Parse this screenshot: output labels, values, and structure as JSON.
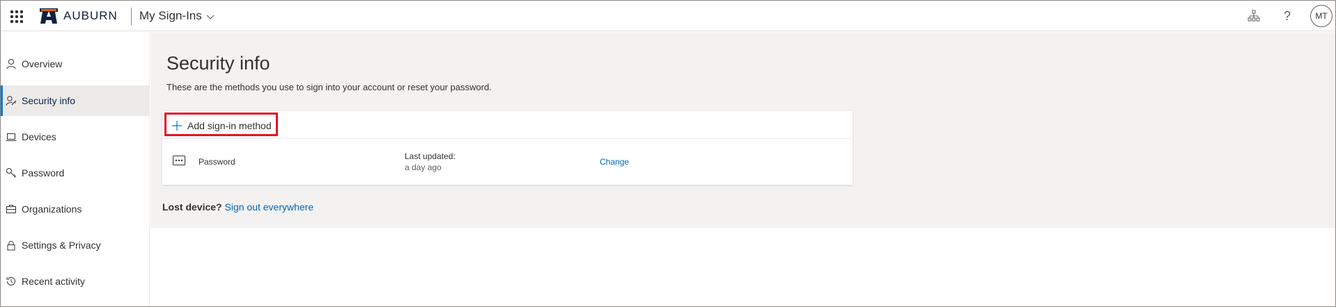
{
  "header": {
    "brand": "AUBURN",
    "app_title": "My Sign-Ins",
    "avatar_initials": "MT",
    "help_symbol": "?"
  },
  "sidebar": {
    "items": [
      {
        "label": "Overview",
        "icon": "person-icon",
        "active": false
      },
      {
        "label": "Security info",
        "icon": "person-key-icon",
        "active": true
      },
      {
        "label": "Devices",
        "icon": "laptop-icon",
        "active": false
      },
      {
        "label": "Password",
        "icon": "key-icon",
        "active": false
      },
      {
        "label": "Organizations",
        "icon": "briefcase-icon",
        "active": false
      },
      {
        "label": "Settings & Privacy",
        "icon": "lock-icon",
        "active": false
      },
      {
        "label": "Recent activity",
        "icon": "history-icon",
        "active": false
      }
    ]
  },
  "main": {
    "title": "Security info",
    "subtitle": "These are the methods you use to sign into your account or reset your password.",
    "add_method_label": "Add sign-in method",
    "methods": [
      {
        "name": "Password",
        "icon": "password-dots-icon",
        "updated_label": "Last updated:",
        "updated_value": "a day ago",
        "action_label": "Change"
      }
    ],
    "lost_device_question": "Lost device?",
    "lost_device_link": "Sign out everywhere"
  },
  "colors": {
    "accent": "#0078d4",
    "link": "#0067b8",
    "highlight_box": "#e81123",
    "brand_navy": "#0c2340",
    "content_bg": "#f3f2f1"
  }
}
